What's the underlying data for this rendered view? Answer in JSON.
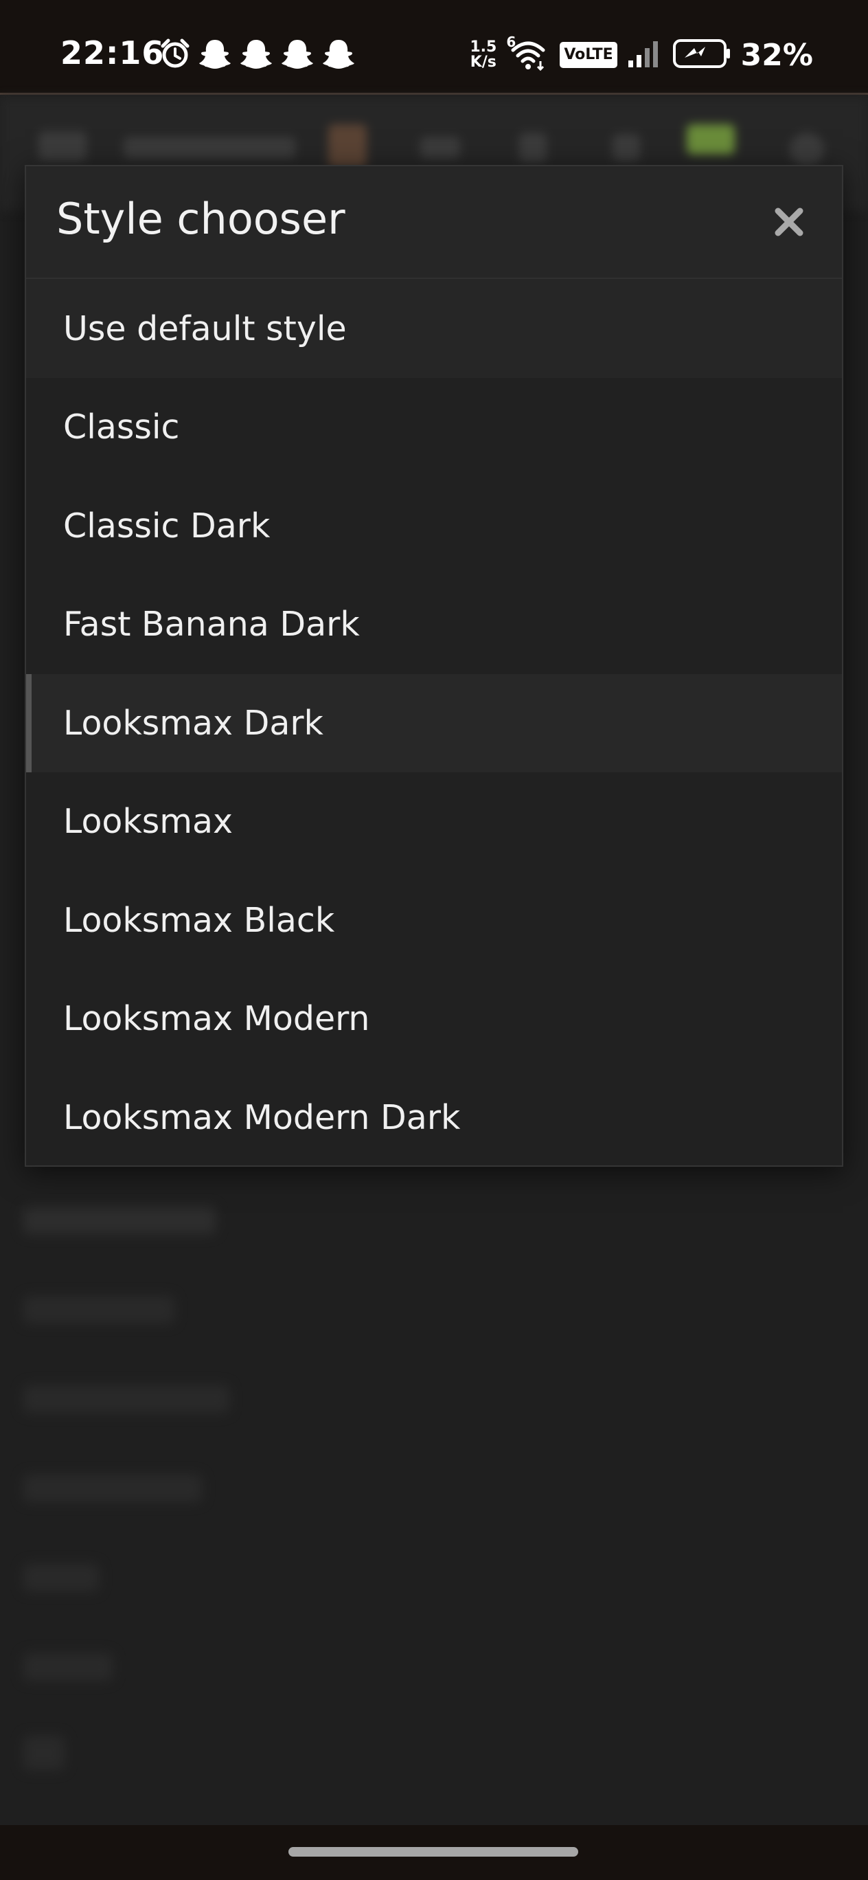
{
  "status_bar": {
    "time": "22:16",
    "net_speed_value": "1.5",
    "net_speed_unit": "K/s",
    "wifi_badge": "6",
    "volte": "VoLTE",
    "battery": "32%"
  },
  "modal": {
    "title": "Style chooser",
    "items": [
      "Use default style",
      "Classic",
      "Classic Dark",
      "Fast Banana Dark",
      "Looksmax Dark",
      "Looksmax",
      "Looksmax Black",
      "Looksmax Modern",
      "Looksmax Modern Dark"
    ],
    "selected_index": 4
  },
  "colors": {
    "background": "#1f1f1f",
    "modal_background": "#212121",
    "modal_header": "#262626",
    "status_bar": "#16110e",
    "text": "#f0f0f0",
    "selected_marker": "#555555"
  }
}
